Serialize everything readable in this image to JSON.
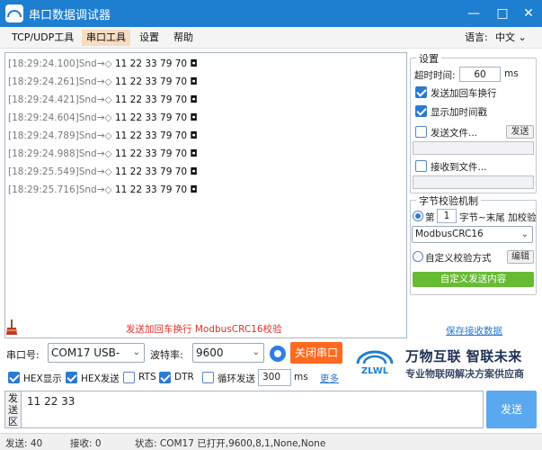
{
  "window": {
    "title": "串口数据调试器",
    "controls": {
      "minimize": "—",
      "maximize": "□",
      "close": "✕"
    }
  },
  "menu": {
    "items": [
      "TCP/UDP工具",
      "串口工具",
      "设置",
      "帮助"
    ],
    "active": "串口工具",
    "language_label": "语言:",
    "language_value": "中文"
  },
  "receive_log": [
    {
      "ts": "[18:29:24.100]",
      "dir": "Snd→◇",
      "data": "11 22 33 79 70 ◘"
    },
    {
      "ts": "[18:29:24.261]",
      "dir": "Snd→◇",
      "data": "11 22 33 79 70 ◘"
    },
    {
      "ts": "[18:29:24.421]",
      "dir": "Snd→◇",
      "data": "11 22 33 79 70 ◘"
    },
    {
      "ts": "[18:29:24.604]",
      "dir": "Snd→◇",
      "data": "11 22 33 79 70 ◘"
    },
    {
      "ts": "[18:29:24.789]",
      "dir": "Snd→◇",
      "data": "11 22 33 79 70 ◘"
    },
    {
      "ts": "[18:29:24.988]",
      "dir": "Snd→◇",
      "data": "11 22 33 79 70 ◘"
    },
    {
      "ts": "[18:29:25.549]",
      "dir": "Snd→◇",
      "data": "11 22 33 79 70 ◘"
    },
    {
      "ts": "[18:29:25.716]",
      "dir": "Snd→◇",
      "data": "11 22 33 79 70 ◘"
    }
  ],
  "receive_hint": "发送加回车换行 ModbusCRC16校验",
  "settings": {
    "title": "设置",
    "timeout_label": "超时时间:",
    "timeout_value": "60",
    "timeout_unit": "ms",
    "send_crlf_label": "发送加回车换行",
    "send_crlf_checked": true,
    "show_timestamp_label": "显示加时间戳",
    "show_timestamp_checked": true,
    "send_file_label": "发送文件...",
    "send_file_checked": false,
    "send_file_button": "发送",
    "recv_file_label": "接收到文件...",
    "recv_file_checked": false
  },
  "checksum": {
    "title": "字节校验机制",
    "byte_prefix": "第",
    "byte_value": "1",
    "byte_suffix": "字节~末尾 加校验",
    "method_value": "ModbusCRC16",
    "custom_label": "自定义校验方式",
    "edit_button": "编辑",
    "custom_send_button": "自定义发送内容",
    "save_received_link": "保存接收数据"
  },
  "port": {
    "port_label": "串口号:",
    "port_value": "COM17 USB-",
    "baud_label": "波特率:",
    "baud_value": "9600",
    "open_close_button": "关闭串口"
  },
  "brand": {
    "logo_text": "ZLWL",
    "slogan": "万物互联 智联未来",
    "sub": "专业物联网解决方案供应商"
  },
  "options": {
    "hex_display_label": "HEX显示",
    "hex_display_checked": true,
    "hex_send_label": "HEX发送",
    "hex_send_checked": true,
    "rts_label": "RTS",
    "rts_checked": false,
    "dtr_label": "DTR",
    "dtr_checked": true,
    "loop_send_label": "循环发送",
    "loop_send_checked": false,
    "loop_interval": "300",
    "loop_unit": "ms",
    "more_link": "更多"
  },
  "send": {
    "side_label": [
      "发",
      "送",
      "区"
    ],
    "content": "11 22 33",
    "send_button": "发送"
  },
  "status_bar": {
    "sent": "发送: 40",
    "received": "接收: 0",
    "state": "状态:  COM17 已打开,9600,8,1,None,None"
  },
  "colors": {
    "titlebar": "#1e7fd0",
    "accent_orange": "#ff6a1e",
    "accent_green": "#66bb33",
    "send_button": "#5aa8ef",
    "hint_red": "#e0302a"
  }
}
